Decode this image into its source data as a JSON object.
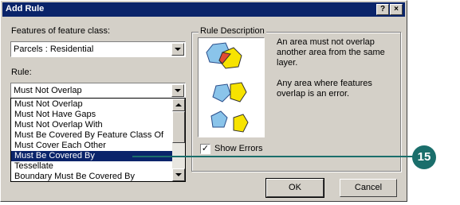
{
  "window": {
    "title": "Add Rule",
    "help_glyph": "?",
    "close_glyph": "×"
  },
  "features": {
    "label": "Features of feature class:",
    "value": "Parcels : Residential"
  },
  "rule": {
    "label": "Rule:",
    "value": "Must Not Overlap",
    "options": [
      "Must Not Overlap",
      "Must Not Have Gaps",
      "Must Not Overlap With",
      "Must Be Covered By Feature Class Of",
      "Must Cover Each Other",
      "Must Be Covered By",
      "Tessellate",
      "Boundary Must Be Covered By"
    ],
    "selected_option": "Must Be Covered By"
  },
  "description": {
    "group_label": "Rule Description",
    "text1": "An area must not overlap another area from the same layer.",
    "text2": "Any area where features overlap is an error."
  },
  "show_errors": {
    "label": "Show Errors",
    "checked": true,
    "check_glyph": "✓"
  },
  "buttons": {
    "ok": "OK",
    "cancel": "Cancel"
  },
  "callout": {
    "number": "15",
    "color": "#1a6e6b"
  },
  "colors": {
    "titlebar": "#0a246a",
    "dialog": "#d4d0c8",
    "shape_blue": "#8ac4ea",
    "shape_yellow": "#f7e300",
    "shape_red": "#e34a2f"
  }
}
